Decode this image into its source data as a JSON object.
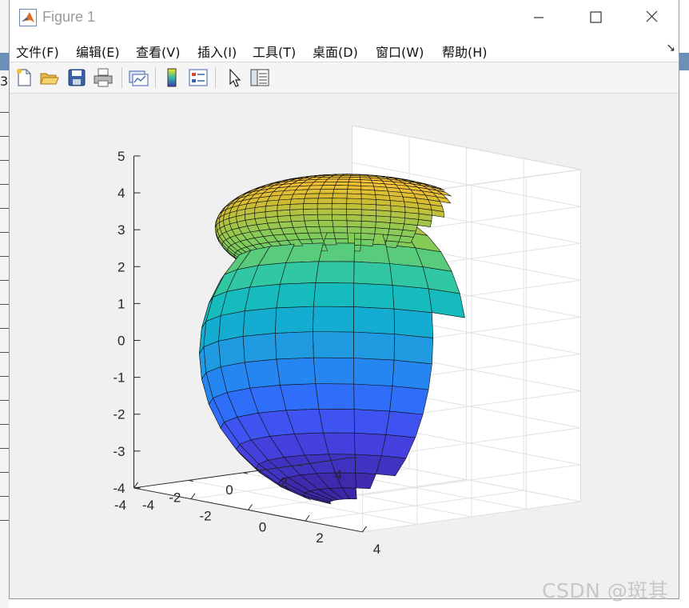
{
  "window": {
    "title": "Figure 1"
  },
  "menu": [
    "文件(F)",
    "编辑(E)",
    "查看(V)",
    "插入(I)",
    "工具(T)",
    "桌面(D)",
    "窗口(W)",
    "帮助(H)"
  ],
  "toolbar": [
    "new-figure-icon",
    "open-file-icon",
    "save-icon",
    "print-icon",
    "link-plot-icon",
    "insert-colorbar-icon",
    "insert-legend-icon",
    "edit-plot-arrow-icon",
    "property-inspector-icon"
  ],
  "left_strip": {
    "glyph": "3"
  },
  "colors": {
    "accent": "#6b8fb8"
  },
  "chart_data": {
    "type": "surface3d",
    "z_ticks": [
      "5",
      "4",
      "3",
      "2",
      "1",
      "0",
      "-1",
      "-2",
      "-3",
      "-4"
    ],
    "y_ticks": [
      "4",
      "2",
      "0",
      "-2",
      "-4"
    ],
    "x_ticks": [
      "-4",
      "-2",
      "0",
      "2",
      "4"
    ],
    "zlim": [
      -4,
      5
    ],
    "ylim": [
      -4,
      4
    ],
    "xlim": [
      -4,
      4
    ],
    "grid": true,
    "surfaces": [
      {
        "shape": "sphere",
        "radius": 4,
        "center": [
          0,
          0,
          -0.3
        ],
        "colormap": "parula"
      },
      {
        "shape": "oblate-spheroid",
        "center": [
          0,
          0,
          3.1
        ],
        "radii": [
          3.6,
          3.6,
          1.45
        ],
        "colormap": "parula"
      }
    ]
  },
  "watermark": "CSDN @斑其"
}
